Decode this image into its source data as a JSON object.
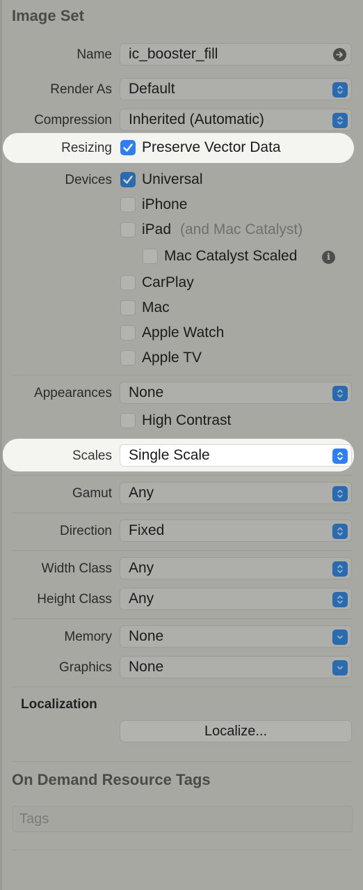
{
  "header": {
    "title": "Image Set"
  },
  "name_row": {
    "label": "Name",
    "value": "ic_booster_fill"
  },
  "render_as": {
    "label": "Render As",
    "value": "Default"
  },
  "compression": {
    "label": "Compression",
    "value": "Inherited (Automatic)"
  },
  "resizing": {
    "label": "Resizing",
    "option": "Preserve Vector Data",
    "checked": true
  },
  "devices": {
    "label": "Devices",
    "universal": "Universal",
    "iphone": "iPhone",
    "ipad": "iPad",
    "ipad_hint": "(and Mac Catalyst)",
    "mac_catalyst_scaled": "Mac Catalyst Scaled",
    "carplay": "CarPlay",
    "mac": "Mac",
    "apple_watch": "Apple Watch",
    "apple_tv": "Apple TV"
  },
  "appearances": {
    "label": "Appearances",
    "value": "None",
    "high_contrast": "High Contrast"
  },
  "scales": {
    "label": "Scales",
    "value": "Single Scale"
  },
  "gamut": {
    "label": "Gamut",
    "value": "Any"
  },
  "direction": {
    "label": "Direction",
    "value": "Fixed"
  },
  "width_class": {
    "label": "Width Class",
    "value": "Any"
  },
  "height_class": {
    "label": "Height Class",
    "value": "Any"
  },
  "memory": {
    "label": "Memory",
    "value": "None"
  },
  "graphics": {
    "label": "Graphics",
    "value": "None"
  },
  "localization": {
    "title": "Localization",
    "button": "Localize..."
  },
  "odr": {
    "title": "On Demand Resource Tags",
    "placeholder": "Tags"
  },
  "colors": {
    "accent": "#2f7ff2",
    "background": "#a8a8a3",
    "highlight": "#f4f4f1"
  }
}
